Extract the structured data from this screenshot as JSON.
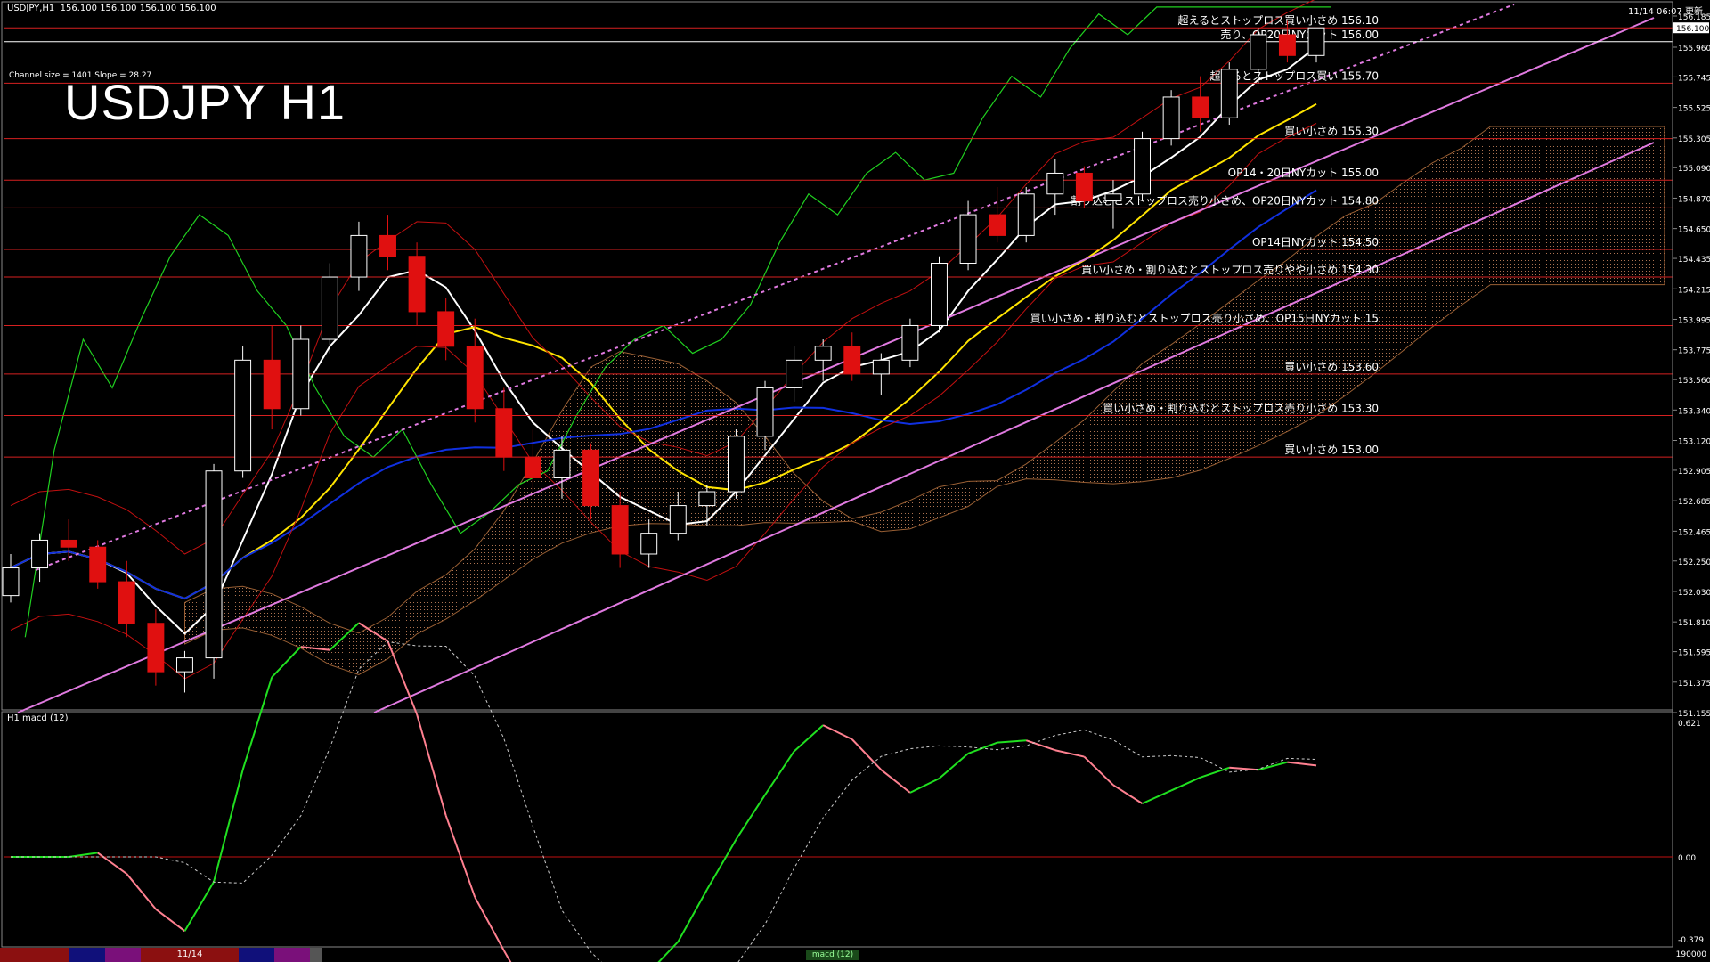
{
  "header": {
    "symbol_tf": "USDJPY,H1",
    "ohlc": "156.100 156.100 156.100 156.100",
    "clock": "11/14 06:07 更新",
    "big_title": "USDJPY H1",
    "channel_info": "Channel size = 1401 Slope = 28.27"
  },
  "macd": {
    "title": "H1  macd (12)",
    "scale": [
      "0.621",
      "0.00",
      "-0.379"
    ]
  },
  "bottom": {
    "date_label": "11/14",
    "right_label": "190000",
    "mid_label": "macd (12)"
  },
  "chart_data": {
    "type": "candlestick",
    "title": "USDJPY H1",
    "ylim": [
      151.155,
      156.185
    ],
    "y_ticks": [
      156.185,
      155.96,
      155.745,
      155.525,
      155.305,
      155.09,
      154.87,
      154.65,
      154.435,
      154.215,
      153.995,
      153.775,
      153.56,
      153.34,
      153.12,
      152.905,
      152.685,
      152.465,
      152.25,
      152.03,
      151.81,
      151.595,
      151.375,
      151.155
    ],
    "y_tick_labels": [
      "156.185",
      "155.960",
      "155.745",
      "155.525",
      "155.305",
      "155.090",
      "154.870",
      "154.650",
      "154.435",
      "154.215",
      "153.995",
      "153.775",
      "153.560",
      "153.340",
      "153.120",
      "152.905",
      "152.685",
      "152.465",
      "152.250",
      "152.030",
      "151.810",
      "151.595",
      "151.375",
      "151.155"
    ],
    "last_price_label": "156.100",
    "candles": [
      [
        152.0,
        152.3,
        151.95,
        152.2
      ],
      [
        152.2,
        152.45,
        152.1,
        152.4
      ],
      [
        152.4,
        152.55,
        152.25,
        152.35
      ],
      [
        152.35,
        152.4,
        152.05,
        152.1
      ],
      [
        152.1,
        152.25,
        151.7,
        151.8
      ],
      [
        151.8,
        151.9,
        151.35,
        151.45
      ],
      [
        151.45,
        151.6,
        151.3,
        151.55
      ],
      [
        151.55,
        152.95,
        151.4,
        152.9
      ],
      [
        152.9,
        153.8,
        152.85,
        153.7
      ],
      [
        153.7,
        153.95,
        153.2,
        153.35
      ],
      [
        153.35,
        153.95,
        153.3,
        153.85
      ],
      [
        153.85,
        154.4,
        153.75,
        154.3
      ],
      [
        154.3,
        154.7,
        154.2,
        154.6
      ],
      [
        154.6,
        154.75,
        154.35,
        154.45
      ],
      [
        154.45,
        154.55,
        153.95,
        154.05
      ],
      [
        154.05,
        154.15,
        153.7,
        153.8
      ],
      [
        153.8,
        154.0,
        153.25,
        153.35
      ],
      [
        153.35,
        153.5,
        152.9,
        153.0
      ],
      [
        153.0,
        153.2,
        152.75,
        152.85
      ],
      [
        152.85,
        153.15,
        152.7,
        153.05
      ],
      [
        153.05,
        153.1,
        152.55,
        152.65
      ],
      [
        152.65,
        152.75,
        152.2,
        152.3
      ],
      [
        152.3,
        152.55,
        152.2,
        152.45
      ],
      [
        152.45,
        152.75,
        152.4,
        152.65
      ],
      [
        152.65,
        152.8,
        152.5,
        152.75
      ],
      [
        152.75,
        153.2,
        152.7,
        153.15
      ],
      [
        153.15,
        153.55,
        153.05,
        153.5
      ],
      [
        153.5,
        153.8,
        153.4,
        153.7
      ],
      [
        153.7,
        153.85,
        153.55,
        153.8
      ],
      [
        153.8,
        153.9,
        153.55,
        153.6
      ],
      [
        153.6,
        153.75,
        153.45,
        153.7
      ],
      [
        153.7,
        154.0,
        153.65,
        153.95
      ],
      [
        153.95,
        154.45,
        153.9,
        154.4
      ],
      [
        154.4,
        154.85,
        154.35,
        154.75
      ],
      [
        154.75,
        154.95,
        154.55,
        154.6
      ],
      [
        154.6,
        154.95,
        154.55,
        154.9
      ],
      [
        154.9,
        155.15,
        154.75,
        155.05
      ],
      [
        155.05,
        155.1,
        154.8,
        154.85
      ],
      [
        154.85,
        155.0,
        154.65,
        154.9
      ],
      [
        154.9,
        155.35,
        154.85,
        155.3
      ],
      [
        155.3,
        155.65,
        155.25,
        155.6
      ],
      [
        155.6,
        155.75,
        155.35,
        155.45
      ],
      [
        155.45,
        155.85,
        155.4,
        155.8
      ],
      [
        155.8,
        156.1,
        155.7,
        156.05
      ],
      [
        156.05,
        156.15,
        155.85,
        155.9
      ],
      [
        155.9,
        156.1,
        155.85,
        156.1
      ]
    ],
    "horizontal_levels": [
      {
        "price": 156.1,
        "label": "超えるとストップロス買い小さめ 156.10",
        "color": "#d62020"
      },
      {
        "price": 156.0,
        "label": "売り、OP20日NYカット 156.00",
        "color": "#ffffff"
      },
      {
        "price": 155.7,
        "label": "超えるとストップロス買い 155.70",
        "color": "#d62020"
      },
      {
        "price": 155.3,
        "label": "買い小さめ 155.30",
        "color": "#d62020"
      },
      {
        "price": 155.0,
        "label": "OP14・20日NYカット 155.00",
        "color": "#d62020"
      },
      {
        "price": 154.8,
        "label": "割り込むとストップロス売り小さめ、OP20日NYカット 154.80",
        "color": "#d62020"
      },
      {
        "price": 154.5,
        "label": "OP14日NYカット 154.50",
        "color": "#d62020"
      },
      {
        "price": 154.3,
        "label": "買い小さめ・割り込むとストップロス売りやや小さめ 154.30",
        "color": "#d62020"
      },
      {
        "price": 153.95,
        "label": "買い小さめ・割り込むとストップロス売り小さめ、OP15日NYカット 15",
        "color": "#d62020"
      },
      {
        "price": 153.6,
        "label": "買い小さめ 153.60",
        "color": "#d62020"
      },
      {
        "price": 153.3,
        "label": "買い小さめ・割り込むとストップロス売り小さめ 153.30",
        "color": "#d62020"
      },
      {
        "price": 153.0,
        "label": "買い小さめ 153.00",
        "color": "#d62020"
      }
    ],
    "colors": {
      "background": "#000000",
      "bull_candle": "#ffffff",
      "bear_candle": "#e01010",
      "channel": "#e07ae0",
      "ma_fast": "#ffffff",
      "ma_slow": "#ffe400",
      "ma_long": "#1030e0",
      "bollinger": "#c01010",
      "chikou": "#20d020",
      "level": "#d62020",
      "macd_up": "#20e020",
      "macd_down": "#ff8090"
    }
  }
}
